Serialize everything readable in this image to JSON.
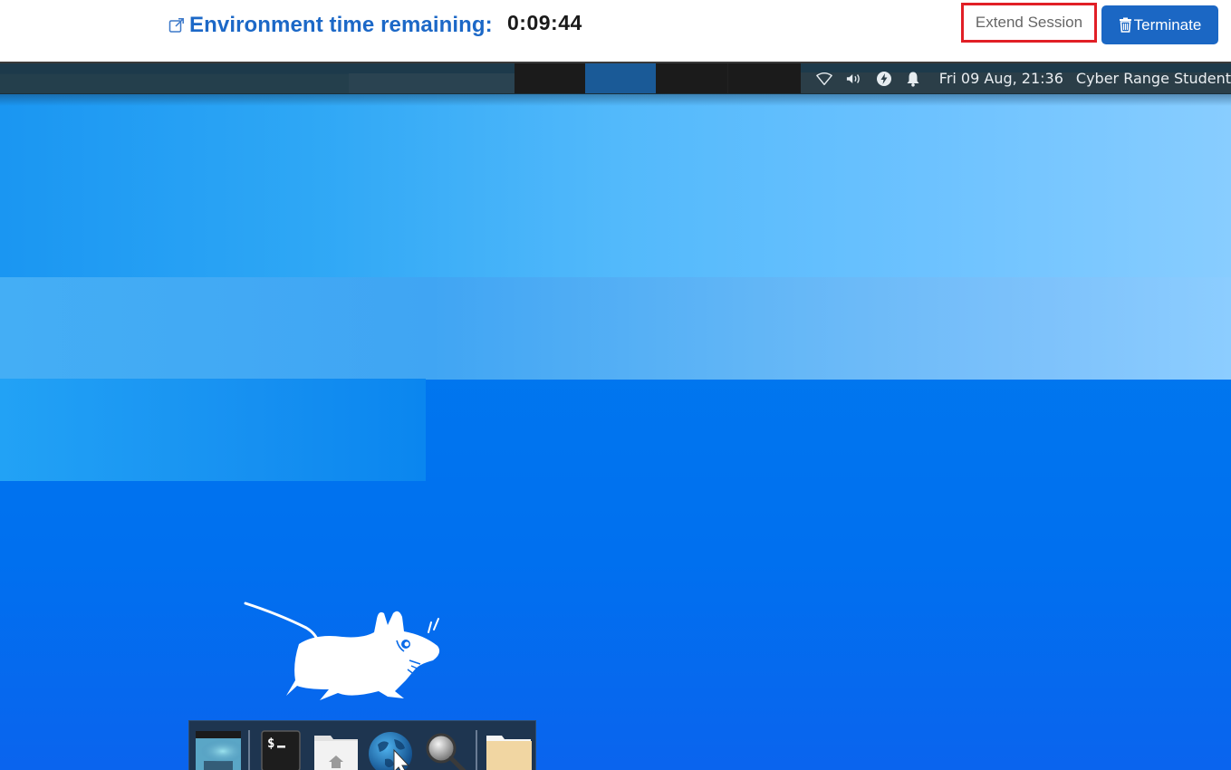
{
  "header": {
    "external_link_icon": "external-link-icon",
    "environment_label": "Environment time remaining:",
    "time_remaining": "0:09:44",
    "extend_button": "Extend Session",
    "terminate_button": "Terminate",
    "terminate_icon": "trash-icon",
    "colors": {
      "accent": "#1c68c7",
      "terminate_bg": "#1b67c4",
      "extend_border": "#e11f26"
    }
  },
  "desktop": {
    "panel": {
      "taskbar_buttons": [
        {
          "state": "inactive"
        },
        {
          "state": "active"
        },
        {
          "state": "inactive"
        },
        {
          "state": "inactive"
        }
      ],
      "tray_icons": [
        "wifi-icon",
        "volume-icon",
        "power-icon",
        "notification-bell-icon"
      ],
      "clock": "Fri 09 Aug, 21:36",
      "user": "Cyber Range Student"
    },
    "dock": {
      "items": [
        {
          "name": "show-desktop",
          "icon": "show-desktop-icon"
        },
        {
          "name": "terminal",
          "icon": "terminal-icon",
          "glyph": "$_"
        },
        {
          "name": "home-folder",
          "icon": "home-folder-icon"
        },
        {
          "name": "web-browser",
          "icon": "globe-icon"
        },
        {
          "name": "app-finder",
          "icon": "magnifier-icon"
        },
        {
          "name": "file-manager",
          "icon": "folder-icon"
        }
      ]
    },
    "logo": "xfce-mouse-logo"
  }
}
